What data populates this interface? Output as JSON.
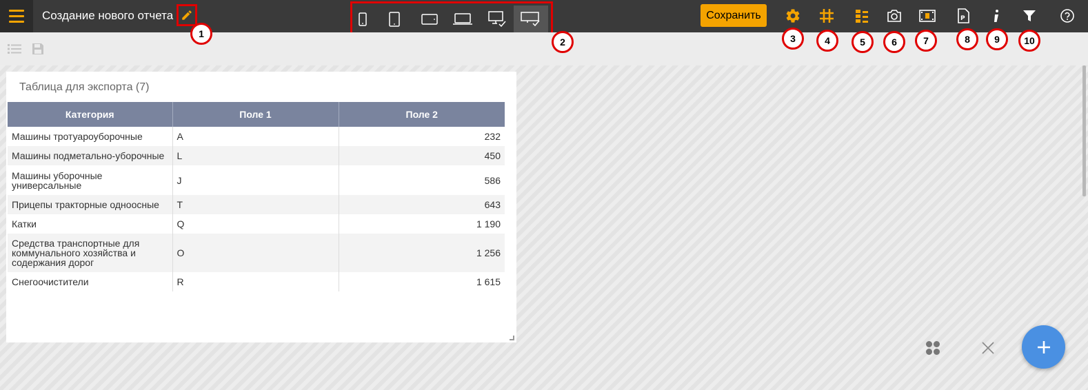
{
  "header": {
    "title": "Создание нового отчета",
    "save_label": "Сохранить"
  },
  "devices": [
    {
      "name": "phone-portrait-icon"
    },
    {
      "name": "tablet-portrait-icon"
    },
    {
      "name": "tablet-landscape-icon"
    },
    {
      "name": "laptop-icon"
    },
    {
      "name": "desktop-checked-icon"
    },
    {
      "name": "wide-screen-checked-icon",
      "active": true
    }
  ],
  "badges": [
    "1",
    "2",
    "3",
    "4",
    "5",
    "6",
    "7",
    "8",
    "9",
    "10"
  ],
  "toolbar_icons": [
    "gear-icon",
    "grid-hash-icon",
    "tree-icon",
    "camera-icon",
    "film-icon",
    "pdf-icon",
    "info-icon",
    "filter-icon",
    "help-icon"
  ],
  "widget": {
    "title": "Таблица для экспорта (7)",
    "columns": [
      "Категория",
      "Поле 1",
      "Поле 2"
    ],
    "rows": [
      {
        "cat": "Машины тротуароуборочные",
        "f1": "A",
        "f2": "232"
      },
      {
        "cat": "Машины подметально-уборочные",
        "f1": "L",
        "f2": "450"
      },
      {
        "cat": "Машины уборочные универсальные",
        "f1": "J",
        "f2": "586"
      },
      {
        "cat": "Прицепы тракторные одноосные",
        "f1": "T",
        "f2": "643"
      },
      {
        "cat": "Катки",
        "f1": "Q",
        "f2": "1 190"
      },
      {
        "cat": "Средства транспортные для коммунального хозяйства и содержания дорог",
        "f1": "O",
        "f2": "1 256"
      },
      {
        "cat": "Снегоочистители",
        "f1": "R",
        "f2": "1 615"
      }
    ]
  },
  "colors": {
    "accent": "#f4a300",
    "topbar": "#3a3a3a",
    "highlight": "#e00000",
    "table_header": "#7a849e",
    "fab": "#4a90e2"
  }
}
